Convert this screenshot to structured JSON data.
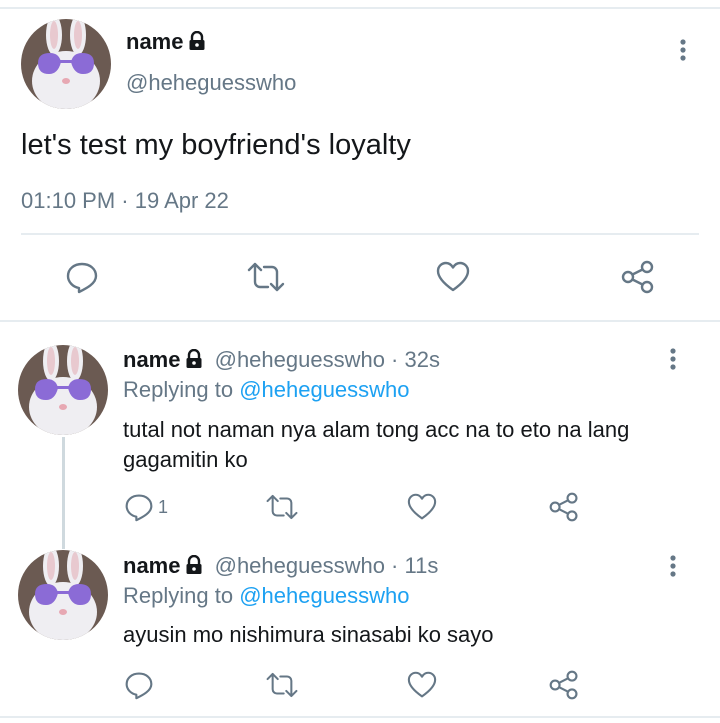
{
  "main_tweet": {
    "name": "name",
    "handle": "@heheguesswho",
    "text": "let's test my boyfriend's loyalty",
    "timestamp": "01:10 PM · 19 Apr 22",
    "actions": [
      "reply-icon",
      "retweet-icon",
      "like-icon",
      "share-icon"
    ]
  },
  "replies": [
    {
      "name": "name",
      "handle_time": "@heheguesswho · 32s",
      "replying_prefix": "Replying to ",
      "replying_handle": "@heheguesswho",
      "text": "tutal not naman nya alam tong acc na to eto na lang gagamitin ko",
      "reply_count": "1"
    },
    {
      "name": "name",
      "handle_time": "@heheguesswho · 11s",
      "replying_prefix": "Replying to ",
      "replying_handle": "@heheguesswho",
      "text": "ayusin mo nishimura sinasabi ko sayo",
      "reply_count": ""
    }
  ],
  "colors": {
    "accent": "#1da1f2",
    "secondary_text": "#657786",
    "divider": "#e6ecf0"
  }
}
